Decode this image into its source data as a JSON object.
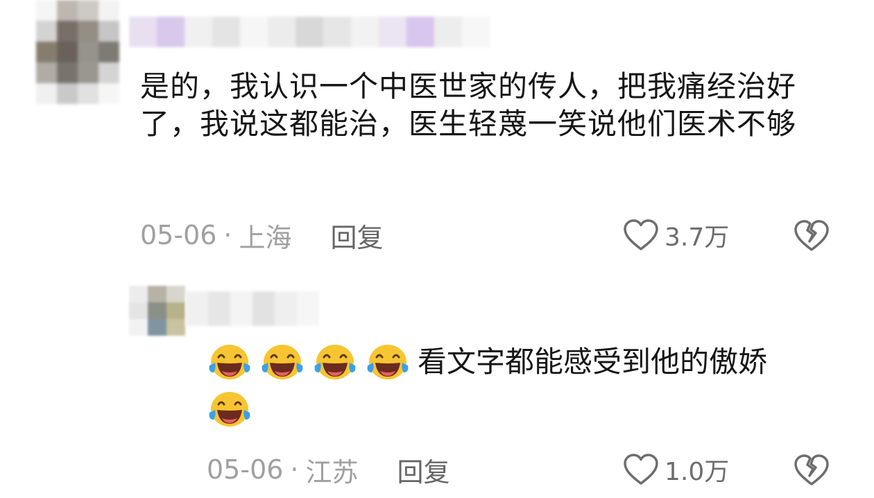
{
  "comments": [
    {
      "text": "是的，我认识一个中医世家的传人，把我痛经治好了，我说这都能治，医生轻蔑一笑说他们医术不够",
      "date": "05-06",
      "location": "上海",
      "reply_label": "回复",
      "likes": "3.7万"
    },
    {
      "text": "看文字都能感受到他的傲娇",
      "date": "05-06",
      "location": "江苏",
      "reply_label": "回复",
      "likes": "1.0万",
      "emoji": "laughing-with-tears-emoji"
    }
  ],
  "separator": "·",
  "icons": {
    "like": "heart-outline-icon",
    "dislike": "broken-heart-icon"
  },
  "colors": {
    "text": "#161616",
    "meta": "#a0a0a0",
    "icon": "#6d6d6d",
    "emoji_face": "#f7c531"
  }
}
